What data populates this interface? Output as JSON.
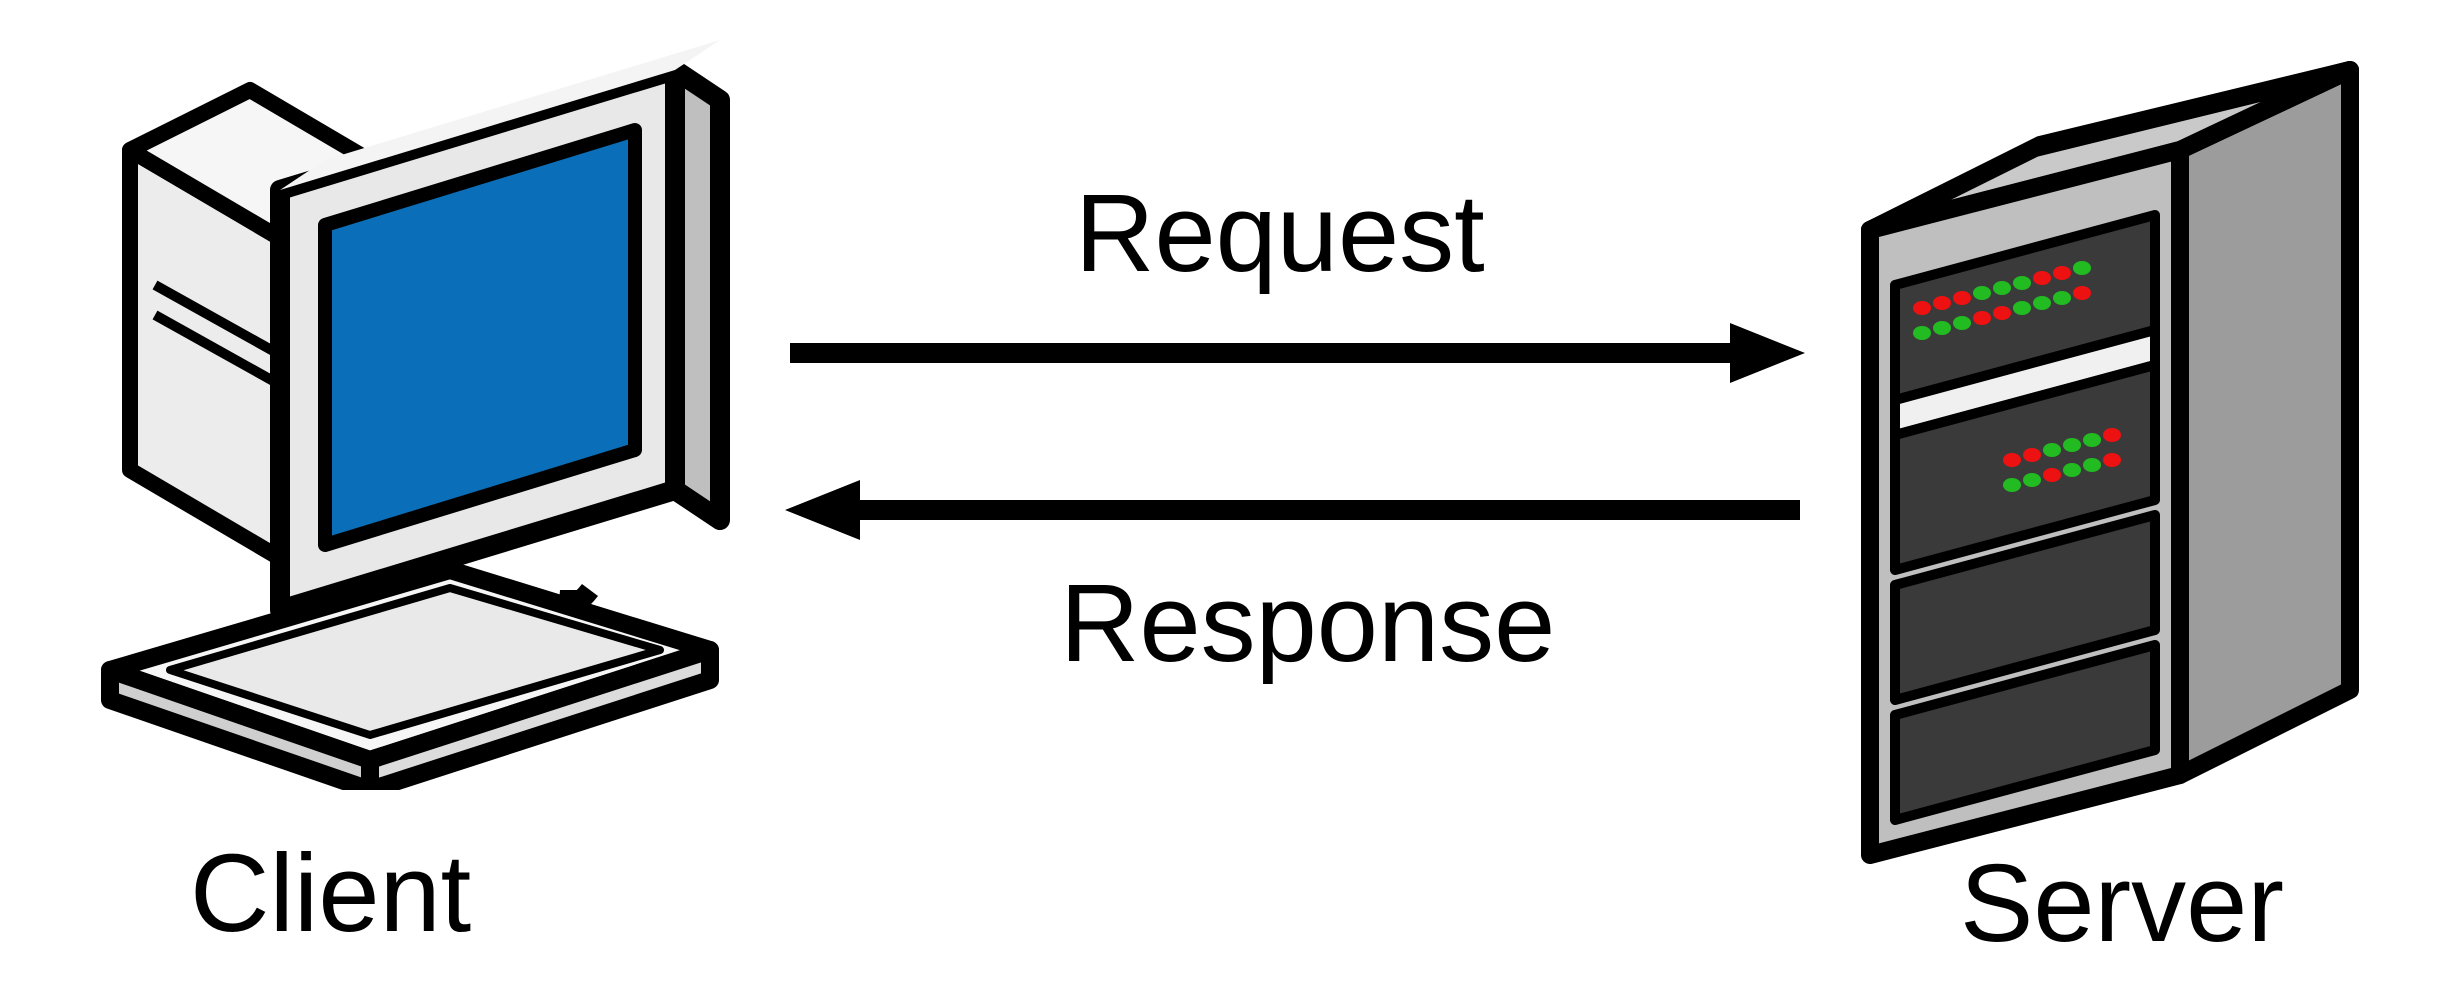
{
  "diagram": {
    "client_label": "Client",
    "server_label": "Server",
    "request_label": "Request",
    "response_label": "Response"
  }
}
